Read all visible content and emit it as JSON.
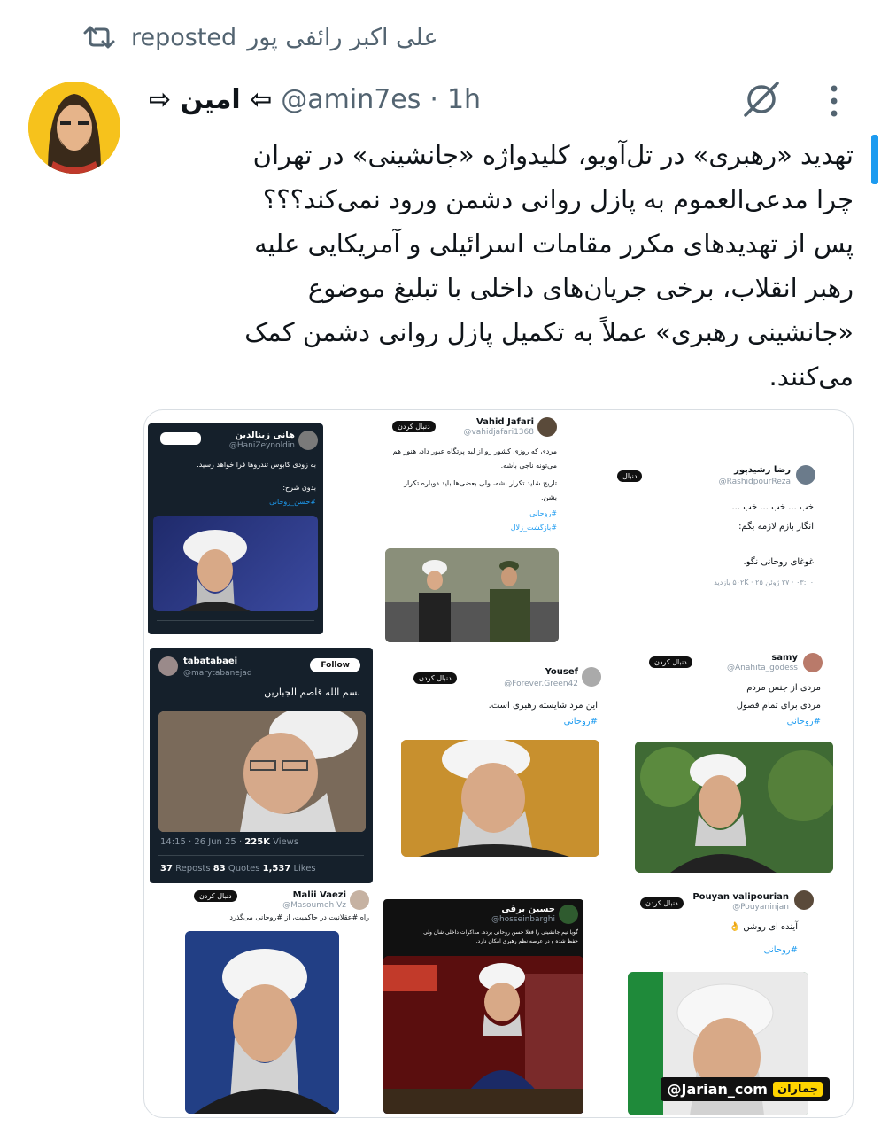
{
  "repost": {
    "label": "reposted",
    "reposter": "علی اکبر رائفی پور"
  },
  "tweet": {
    "display_name": "⇦ امین ⇨",
    "handle": "@amin7es",
    "separator": "·",
    "time": "1h",
    "text_lines": [
      "تهدید «رهبری» در تل‌آویو، کلیدواژه «جانشینی» در تهران",
      "چرا مدعی‌العموم به پازل روانی دشمن ورود نمی‌کند؟؟؟",
      "پس از تهدیدهای مکرر مقامات اسرائیلی و آمریکایی علیه",
      "رهبر انقلاب، برخی جریان‌های داخلی با تبلیغ موضوع",
      "«جانشینی رهبری» عملاً به تکمیل پازل روانی دشمن کمک",
      "می‌کنند."
    ]
  },
  "icons": {
    "repost": "repost-icon",
    "grok": "grok-icon",
    "more": "more-vertical-icon"
  },
  "colors": {
    "text": "#0f1419",
    "secondary": "#536471",
    "accent": "#1d9bf0"
  },
  "collage": {
    "c1": {
      "name": "هانی زینالدین",
      "handle": "@HaniZeynoldin",
      "text": "به زودی کابوس تندروها فرا خواهد رسید.",
      "text2": "بدون شرح:",
      "hashtag": "#حسن_روحانی"
    },
    "c2": {
      "name": "Vahid Jafari",
      "handle": "@vahidjafari1368",
      "text": "مردی که روزی کشور رو از لبه پرتگاه عبور داد، هنوز هم",
      "text2": "می‌تونه ناجی باشه.",
      "text3": "تاریخ شاید تکرار نشه، ولی بعضی‌ها باید دوباره تکرار",
      "text4": "بشن.",
      "hashtag": "#روحانی",
      "hashtag2": "#بازگشت_زلال",
      "follow": "دنبال کردن"
    },
    "c3": {
      "name": "رضا رشیدپور",
      "handle": "@RashidpourReza",
      "follow": "دنبال",
      "text": "خب ... خب ... خب ...",
      "text2": "انگار بازم لازمه بگم:",
      "text3": "غوغای روحانی نگو.",
      "stats": "۰۳:۰۰ · ۲۷ ژوئن ۲۵ · ۵۰۲K بازدید"
    },
    "c4": {
      "name": "tabatabaei",
      "handle": "@marytabanejad",
      "follow": "Follow",
      "text": "بسم الله قاصم الجبارين",
      "time": "14:15 · 26 Jun 25 · ",
      "views": "225K",
      "views_label": " Views",
      "reposts": "37",
      "reposts_label": " Reposts  ",
      "quotes": "83",
      "quotes_label": " Quotes  ",
      "likes": "1,537",
      "likes_label": " Likes"
    },
    "c5": {
      "name": "Yousef",
      "handle": "@Forever.Green42",
      "follow": "دنبال کردن",
      "text": "این مرد شایسته رهبری است.",
      "hashtag": "#روحانی"
    },
    "c6": {
      "name": "samy",
      "handle": "@Anahita_godess",
      "follow": "دنبال کردن",
      "text": "مردی از جنس مردم",
      "text2": "مردی برای تمام فصول",
      "hashtag": "#روحانی"
    },
    "c7": {
      "name": "Malii Vaezi",
      "handle": "@Masoumeh Vz",
      "follow": "دنبال کردن",
      "text": "راه #عقلانیت در حاکمیت، از #روحانی می‌گذرد"
    },
    "c8": {
      "name": "حسین برقی",
      "handle": "@hosseinbarghi",
      "text": "گویا تیم جانشینی را فعلا حسن روحانی برده. مذاکرات داخلی شان ولی",
      "text2": "حفظ شده و در عرصه نظم رهبری امکان دارد."
    },
    "c9": {
      "name": "Pouyan valipourian",
      "handle": "@Pouyaninjan",
      "follow": "دنبال کردن",
      "text": "آینده ای روشن 👌",
      "hashtag": "#روحانی"
    },
    "watermark": {
      "logo": "جماران",
      "handle": "@Jarian_com"
    }
  }
}
